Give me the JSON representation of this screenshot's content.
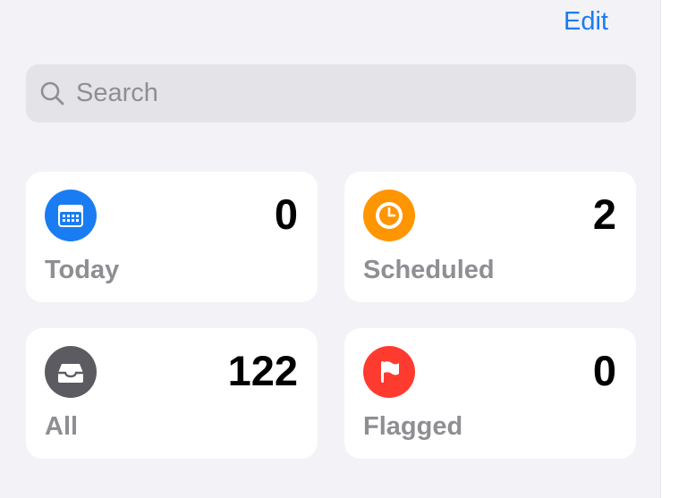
{
  "header": {
    "edit_label": "Edit"
  },
  "search": {
    "placeholder": "Search",
    "value": ""
  },
  "colors": {
    "accent": "#1a7cf2",
    "today": "#1a7cf2",
    "scheduled": "#ff9500",
    "all": "#5b5b61",
    "flagged": "#ff3b30"
  },
  "smart_lists": {
    "today": {
      "label": "Today",
      "count": "0",
      "icon": "calendar-icon"
    },
    "scheduled": {
      "label": "Scheduled",
      "count": "2",
      "icon": "clock-icon"
    },
    "all": {
      "label": "All",
      "count": "122",
      "icon": "tray-icon"
    },
    "flagged": {
      "label": "Flagged",
      "count": "0",
      "icon": "flag-icon"
    }
  }
}
